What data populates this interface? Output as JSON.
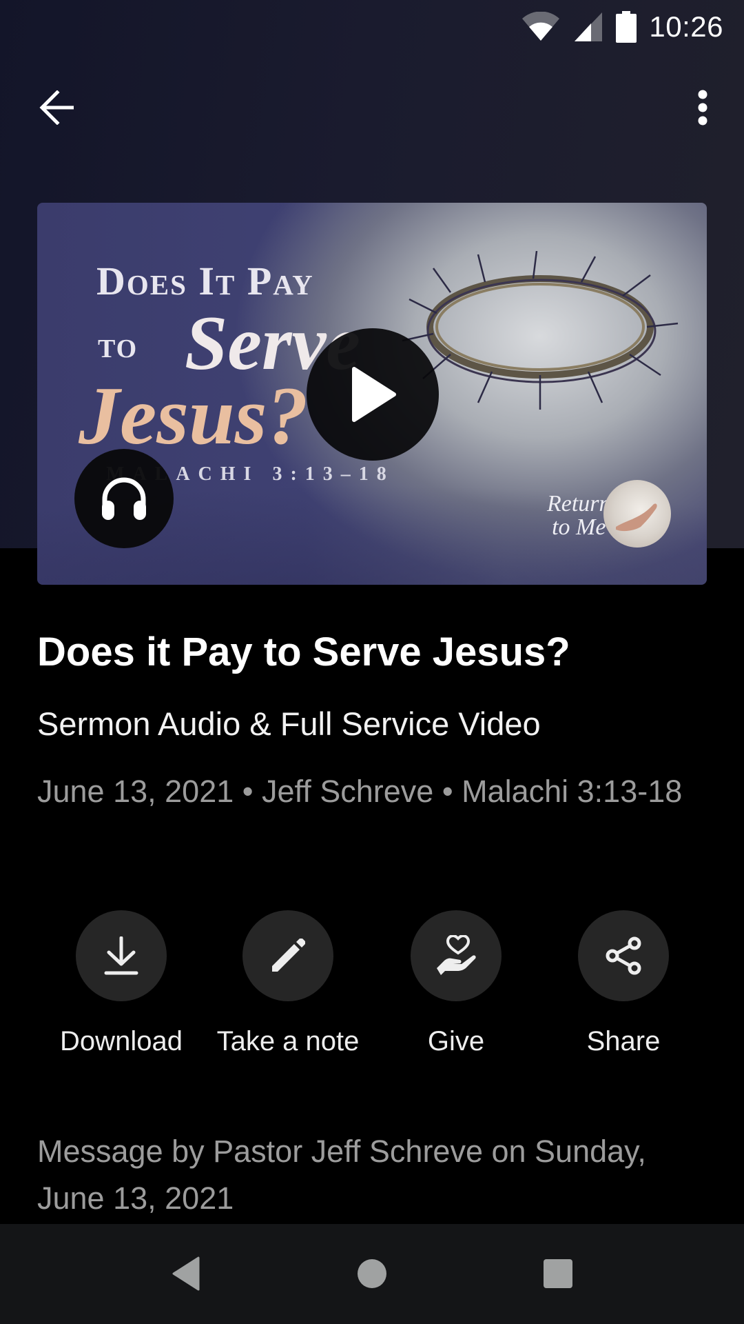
{
  "status_bar": {
    "time": "10:26",
    "icons": [
      "wifi-icon",
      "cellular-signal-icon",
      "battery-icon"
    ]
  },
  "app_bar": {
    "back_icon": "arrow-back-icon",
    "menu_icon": "more-vert-icon"
  },
  "thumbnail": {
    "title_line1": "Does It Pay",
    "title_line2a": "to",
    "title_line2b": "Serve",
    "title_line3": "Jesus?",
    "scripture": "MALACHI 3:13–18",
    "series_line1": "Return",
    "series_line2": "to Me",
    "play_icon": "play-icon",
    "audio_icon": "headphones-icon"
  },
  "sermon": {
    "title": "Does it Pay to Serve Jesus?",
    "subtitle": "Sermon Audio & Full Service Video",
    "meta": "June 13, 2021 • Jeff Schreve • Malachi 3:13-18",
    "description": "Message by Pastor Jeff Schreve on Sunday, June 13, 2021"
  },
  "actions": [
    {
      "label": "Download",
      "icon": "download-icon"
    },
    {
      "label": "Take a note",
      "icon": "pencil-icon"
    },
    {
      "label": "Give",
      "icon": "give-hand-heart-icon"
    },
    {
      "label": "Share",
      "icon": "share-icon"
    }
  ],
  "nav_bar": {
    "back": "nav-back-icon",
    "home": "nav-home-icon",
    "recents": "nav-recents-icon"
  },
  "colors": {
    "background": "#000000",
    "header_gradient_start": "#131529",
    "header_gradient_end": "#20202c",
    "action_circle": "#262626",
    "meta_text": "#9c9c9c",
    "nav_bar": "#141517",
    "nav_icons": "#a0a2a2"
  }
}
